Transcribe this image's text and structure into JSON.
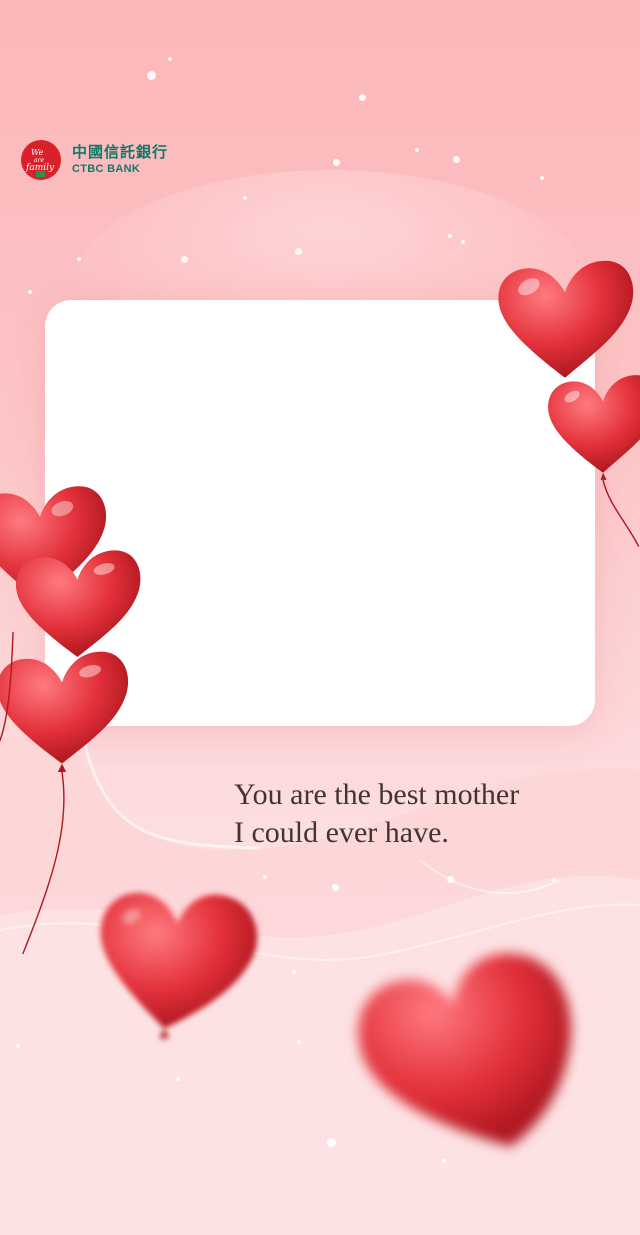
{
  "brand": {
    "name_cn": "中國信託銀行",
    "name_en": "CTBC BANK",
    "badge_icon": "we-are-family-logo",
    "badge_color": "#d8212a",
    "text_color": "#0f7a6a"
  },
  "photo_frame": {
    "icon": "blank-photo-frame"
  },
  "message": {
    "line1": "You are the best mother",
    "line2": "I could ever have."
  },
  "decor": {
    "heart_color": "#e8333b",
    "icons": [
      "heart-balloon-icon",
      "snow-dot"
    ]
  }
}
